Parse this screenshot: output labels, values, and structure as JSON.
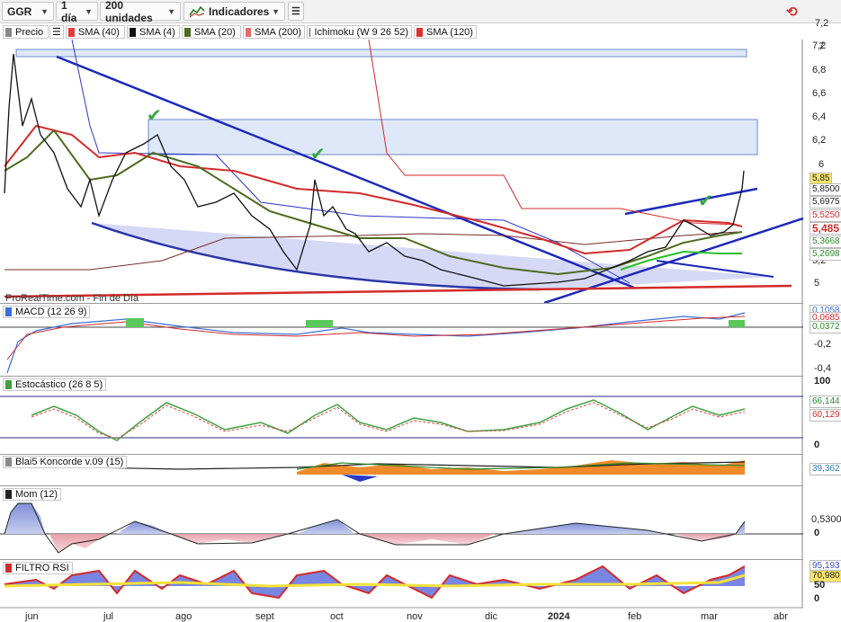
{
  "toolbar": {
    "symbol": "GGR",
    "timeframe": "1 día",
    "units": "200 unidades",
    "indicators_label": "Indicadores",
    "icons": [
      "chevron-down-icon",
      "indicators-chart-icon",
      "list-icon",
      "refresh-icon"
    ]
  },
  "legend": [
    {
      "label": "Precio",
      "color": "#888888"
    },
    {
      "label": "",
      "icon": "list-icon",
      "color": "#333333"
    },
    {
      "label": "SMA (40)",
      "color": "#e23b3b"
    },
    {
      "label": "SMA (4)",
      "color": "#111111"
    },
    {
      "label": "SMA (20)",
      "color": "#4d6b1f"
    },
    {
      "label": "SMA (200)",
      "color": "#e86b6b"
    },
    {
      "label": "Ichimoku (W 9 26 52)",
      "color": "#7a3a8a"
    },
    {
      "label": "SMA (120)",
      "color": "#e03030"
    }
  ],
  "watermark": "ProRealTime.com - Fin de Día",
  "price_axis": [
    "7,2",
    "7",
    "6,8",
    "6,6",
    "6,4",
    "6,2",
    "6",
    "5",
    "5,2"
  ],
  "price_tags": [
    {
      "text": "5,85",
      "bg": "#f7e36a"
    },
    {
      "text": "5,8500",
      "bg": "#ffffff"
    },
    {
      "text": "5,6975",
      "bg": "#ffffff"
    },
    {
      "text": "5,5250",
      "bg": "#ffffff"
    },
    {
      "text": "5,485",
      "bg": "#ffffff"
    },
    {
      "text": "5,3668",
      "bg": "#ffffff"
    },
    {
      "text": "5,2698",
      "bg": "#ffffff"
    }
  ],
  "panels": {
    "macd": {
      "title": "MACD (12 26 9)",
      "axis": [
        "0",
        "-0,2",
        "-0,4"
      ],
      "tags": [
        "0,1058",
        "0,0685",
        "0,0372"
      ]
    },
    "stoch": {
      "title": "Estocástico (26 8 5)",
      "axis": [
        "100",
        "0"
      ],
      "tags": [
        "66,144",
        "60,129"
      ]
    },
    "koncorde": {
      "title": "Blai5 Koncorde v.09 (15)",
      "tags": [
        "39,362"
      ]
    },
    "mom": {
      "title": "Mom (12)",
      "axis": [
        "0,5300",
        "0"
      ],
      "tags": [
        "0,5300"
      ]
    },
    "rsi": {
      "title": "FILTRO RSI",
      "axis": [
        "50",
        "0"
      ],
      "tags": [
        "95,193",
        "70,980"
      ]
    }
  },
  "months": [
    "jun",
    "jul",
    "ago",
    "sept",
    "oct",
    "nov",
    "dic",
    "2024",
    "feb",
    "mar",
    "abr"
  ]
}
